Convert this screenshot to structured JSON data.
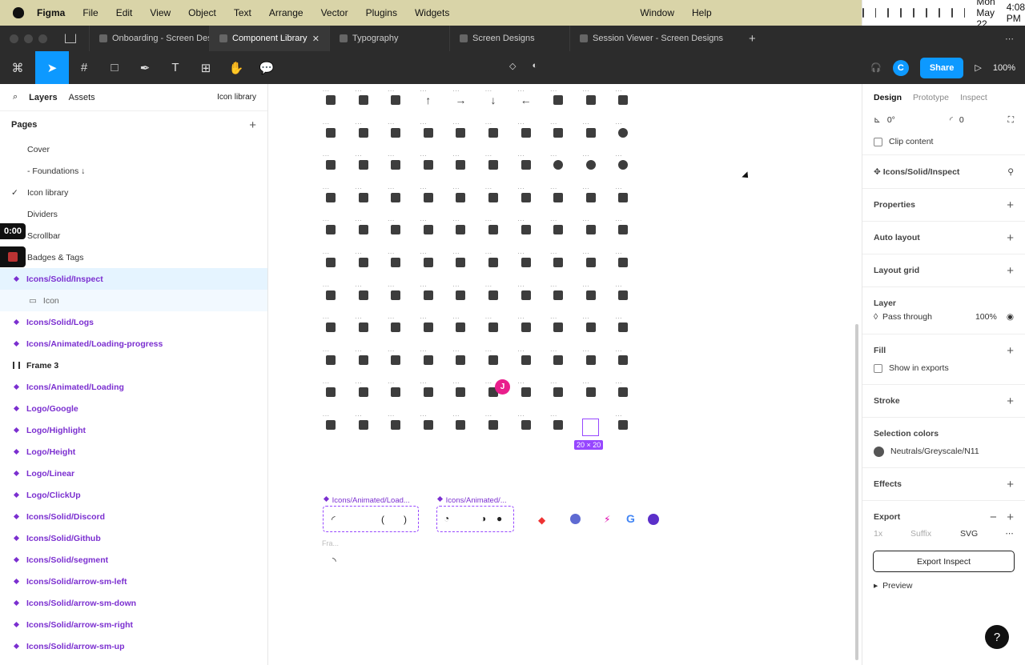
{
  "menubar": {
    "app": "Figma",
    "items": [
      "File",
      "Edit",
      "View",
      "Object",
      "Text",
      "Arrange",
      "Vector",
      "Plugins",
      "Widgets"
    ],
    "window": "Window",
    "help": "Help",
    "date": "Mon May 22",
    "time": "4:08 PM"
  },
  "tabs": [
    {
      "label": "Onboarding - Screen Designs"
    },
    {
      "label": "Component Library",
      "active": true
    },
    {
      "label": "Typography"
    },
    {
      "label": "Screen Designs"
    },
    {
      "label": "Session Viewer - Screen Designs"
    }
  ],
  "toolbar": {
    "avatar": "C",
    "share": "Share",
    "zoom": "100%"
  },
  "left": {
    "tab_layers": "Layers",
    "tab_assets": "Assets",
    "page_selector": "Icon library",
    "pages_title": "Pages",
    "pages": [
      "Cover",
      "- Foundations ↓",
      "Icon library",
      "Dividers",
      "Scrollbar",
      "Badges & Tags"
    ],
    "timer": "0:00",
    "layers": [
      {
        "label": "Icons/Solid/Inspect",
        "kind": "component",
        "selected": true
      },
      {
        "label": "Icon",
        "kind": "sub"
      },
      {
        "label": "Icons/Solid/Logs",
        "kind": "component"
      },
      {
        "label": "Icons/Animated/Loading-progress",
        "kind": "component"
      },
      {
        "label": "Frame 3",
        "kind": "frame"
      },
      {
        "label": "Icons/Animated/Loading",
        "kind": "component"
      },
      {
        "label": "Logo/Google",
        "kind": "component"
      },
      {
        "label": "Logo/Highlight",
        "kind": "component"
      },
      {
        "label": "Logo/Height",
        "kind": "component"
      },
      {
        "label": "Logo/Linear",
        "kind": "component"
      },
      {
        "label": "Logo/ClickUp",
        "kind": "component"
      },
      {
        "label": "Icons/Solid/Discord",
        "kind": "component"
      },
      {
        "label": "Icons/Solid/Github",
        "kind": "component"
      },
      {
        "label": "Icons/Solid/segment",
        "kind": "component"
      },
      {
        "label": "Icons/Solid/arrow-sm-left",
        "kind": "component"
      },
      {
        "label": "Icons/Solid/arrow-sm-down",
        "kind": "component"
      },
      {
        "label": "Icons/Solid/arrow-sm-right",
        "kind": "component"
      },
      {
        "label": "Icons/Solid/arrow-sm-up",
        "kind": "component"
      }
    ]
  },
  "canvas": {
    "size_badge": "20 × 20",
    "cursor_user": "J",
    "anim1_label": "Icons/Animated/Load...",
    "anim2_label": "Icons/Animated/...",
    "frame_label": "Fra...",
    "dots": "...",
    "accent": "#9747ff"
  },
  "right": {
    "tab_design": "Design",
    "tab_prototype": "Prototype",
    "tab_inspect": "Inspect",
    "rotation": "0°",
    "radius": "0",
    "clip": "Clip content",
    "component_name": "Icons/Solid/Inspect",
    "properties": "Properties",
    "auto_layout": "Auto layout",
    "layout_grid": "Layout grid",
    "layer": "Layer",
    "blend": "Pass through",
    "opacity": "100%",
    "fill": "Fill",
    "show_exports": "Show in exports",
    "stroke": "Stroke",
    "selection_colors": "Selection colors",
    "color_name": "Neutrals/Greyscale/N11",
    "effects": "Effects",
    "export": "Export",
    "scale": "1x",
    "suffix": "Suffix",
    "format": "SVG",
    "export_btn": "Export Inspect",
    "preview": "Preview",
    "help": "?"
  }
}
